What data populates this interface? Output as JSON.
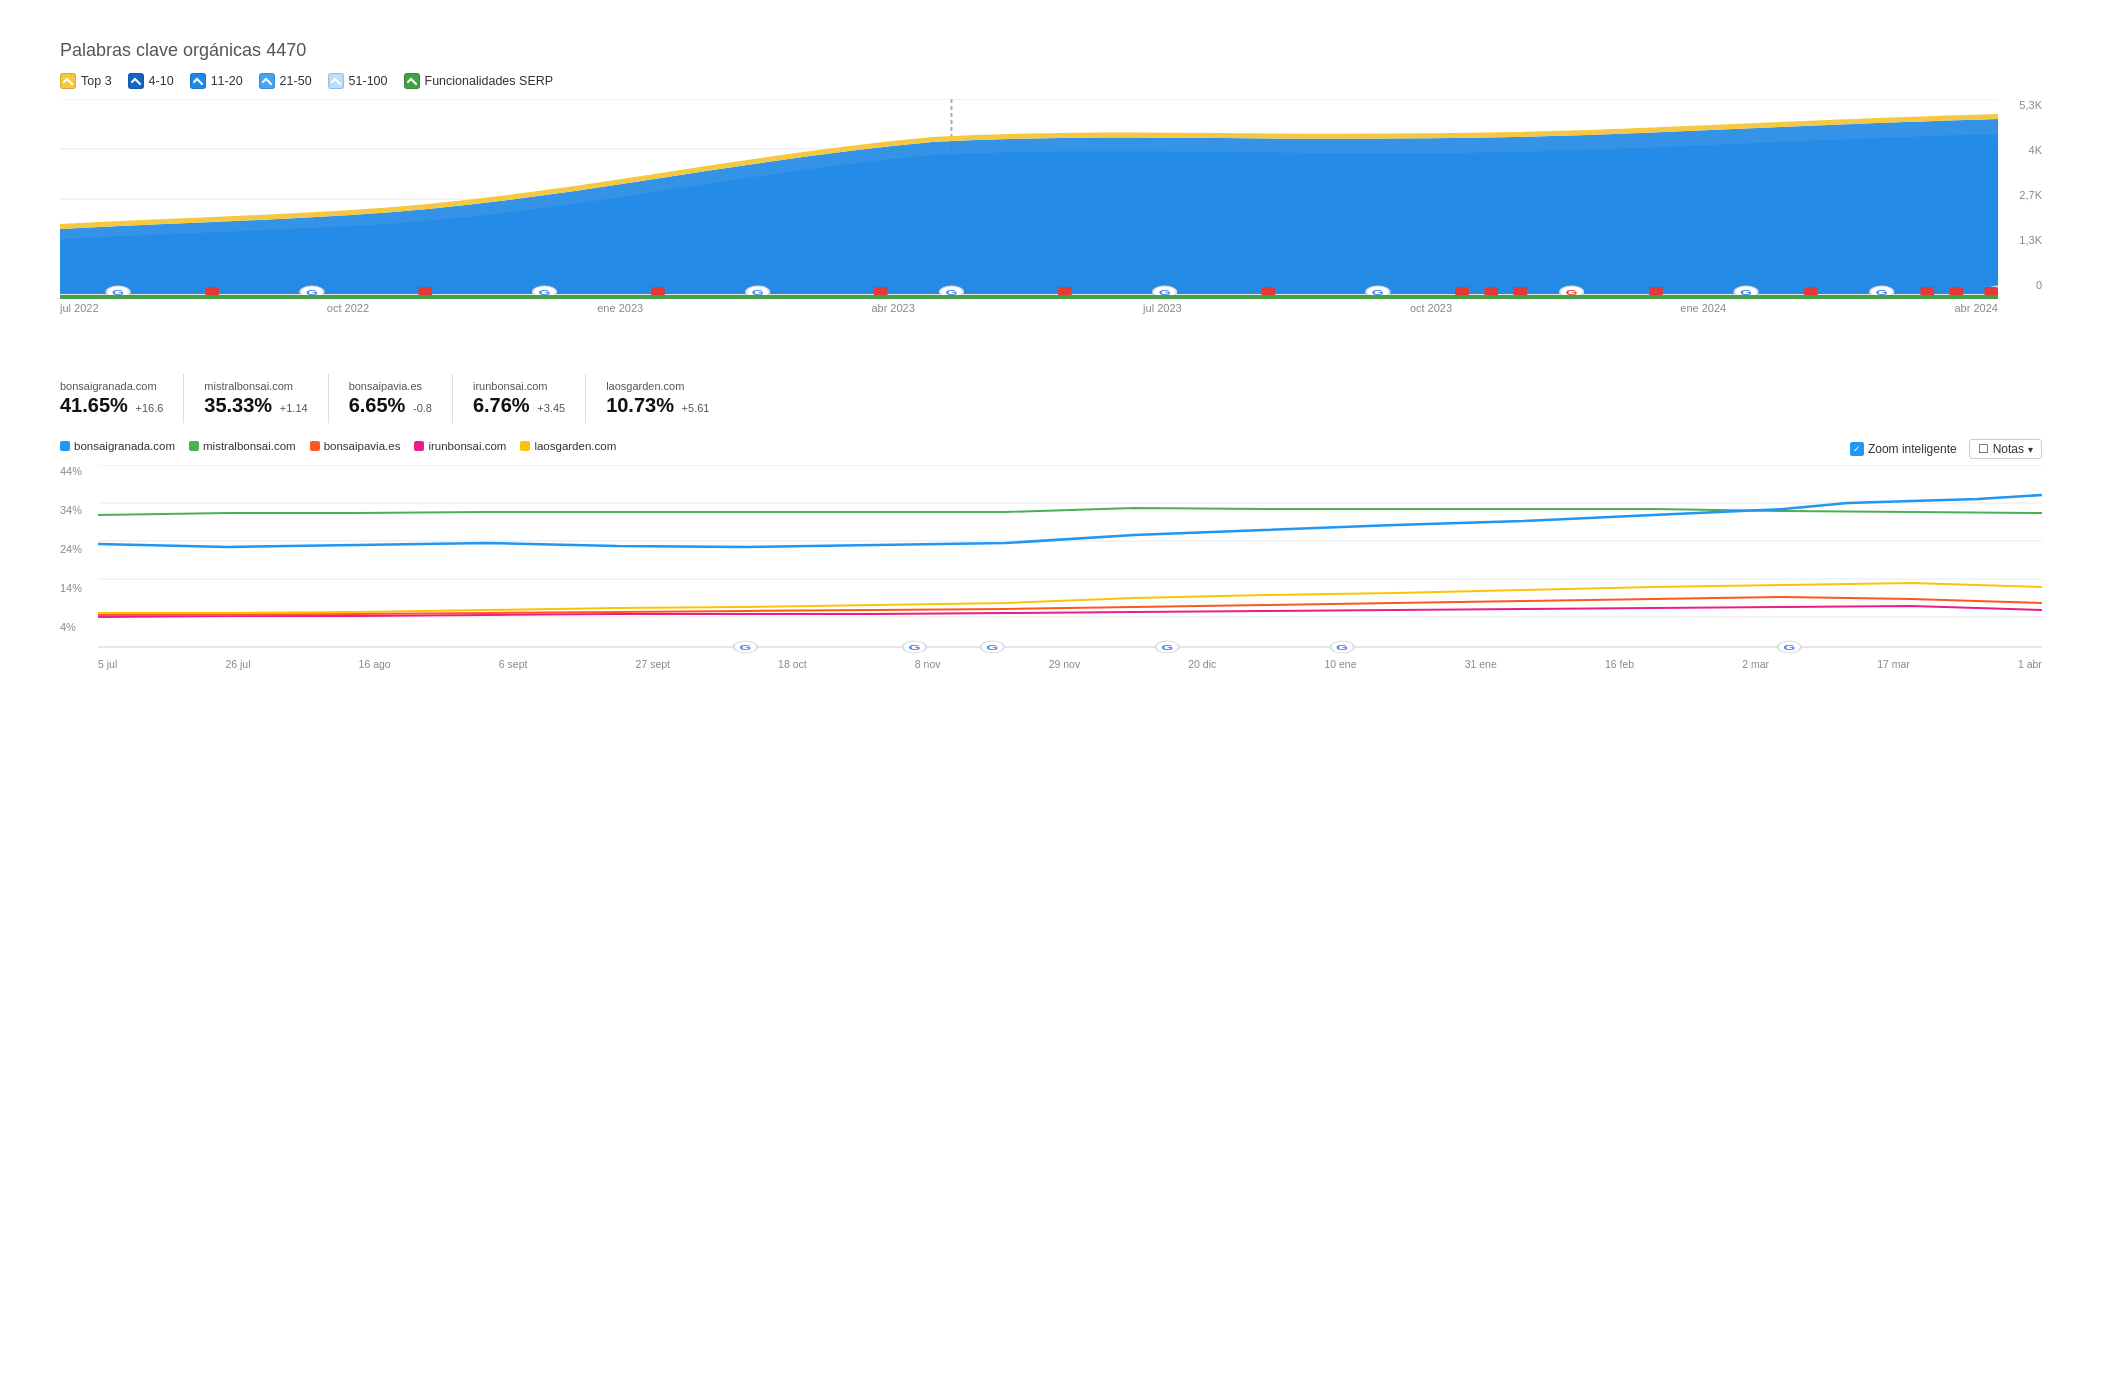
{
  "page": {
    "title": "Palabras clave orgánicas",
    "title_count": "4470"
  },
  "legend": [
    {
      "id": "top3",
      "label": "Top 3",
      "color": "#F5C842",
      "checked": true
    },
    {
      "id": "4-10",
      "label": "4-10",
      "color": "#1565C0",
      "checked": true
    },
    {
      "id": "11-20",
      "label": "11-20",
      "color": "#1E88E5",
      "checked": true
    },
    {
      "id": "21-50",
      "label": "21-50",
      "color": "#42A5F5",
      "checked": true
    },
    {
      "id": "51-100",
      "label": "51-100",
      "color": "#90CAF9",
      "checked": true
    },
    {
      "id": "serp",
      "label": "Funcionalidades SERP",
      "color": "#43A047",
      "checked": true
    }
  ],
  "chart1": {
    "y_labels": [
      "5,3K",
      "4K",
      "2,7K",
      "1,3K",
      "0"
    ],
    "x_labels": [
      "jul 2022",
      "oct 2022",
      "ene 2023",
      "apr 2023",
      "jul 2023",
      "oct 2023",
      "ene 2024",
      "abr 2024"
    ]
  },
  "stats": [
    {
      "domain": "bonsaigranada.com",
      "value": "41.65%",
      "delta": "+16.6"
    },
    {
      "domain": "mistralbonsai.com",
      "value": "35.33%",
      "delta": "+1.14"
    },
    {
      "domain": "bonsaipavia.es",
      "value": "6.65%",
      "delta": "-0.8"
    },
    {
      "domain": "irunbonsai.com",
      "value": "6.76%",
      "delta": "+3.45"
    },
    {
      "domain": "laosgarden.com",
      "value": "10.73%",
      "delta": "+5.61"
    }
  ],
  "legend2": [
    {
      "label": "bonsaigranada.com",
      "color": "#2196F3"
    },
    {
      "label": "mistralbonsai.com",
      "color": "#4CAF50"
    },
    {
      "label": "bonsaipavia.es",
      "color": "#FF5722"
    },
    {
      "label": "irunbonsai.com",
      "color": "#E91E8C"
    },
    {
      "label": "laosgarden.com",
      "color": "#FFC107"
    }
  ],
  "chart2": {
    "y_labels": [
      "44%",
      "34%",
      "24%",
      "14%",
      "4%"
    ],
    "x_labels": [
      "5 jul",
      "26 jul",
      "16 ago",
      "6 sept",
      "27 sept",
      "18 oct",
      "8 nov",
      "29 nov",
      "20 dic",
      "10 ene",
      "31 ene",
      "16 feb",
      "2 mar",
      "17 mar",
      "1 abr"
    ]
  },
  "controls": {
    "zoom_label": "Zoom inteligente",
    "notas_label": "Notas"
  }
}
